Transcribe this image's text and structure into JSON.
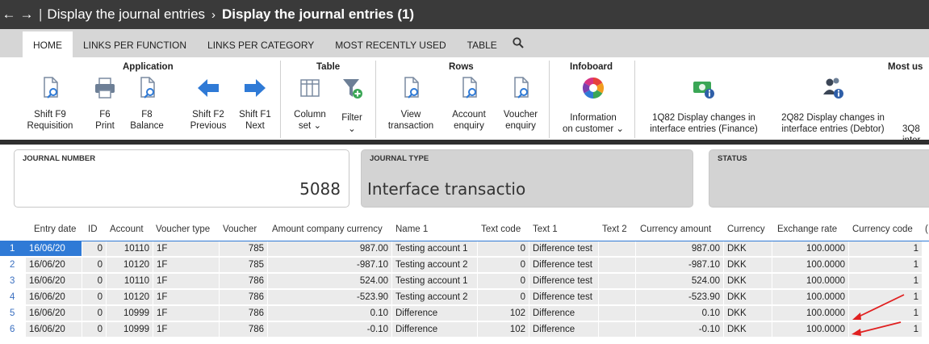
{
  "titlebar": {
    "back_glyph": "←",
    "forward_glyph": "→",
    "separator": "|",
    "breadcrumb_parent": "Display the journal entries",
    "crumb_separator": "›",
    "current": "Display the journal entries (1)"
  },
  "tabs": [
    {
      "label": "HOME",
      "active": true
    },
    {
      "label": "LINKS PER FUNCTION"
    },
    {
      "label": "LINKS PER CATEGORY"
    },
    {
      "label": "MOST RECENTLY USED"
    },
    {
      "label": "TABLE"
    }
  ],
  "ribbon": {
    "groups": {
      "application": "Application",
      "table": "Table",
      "rows": "Rows",
      "infoboard": "Infoboard",
      "most_used": "Most us"
    },
    "buttons": {
      "requisition": {
        "line1": "Shift F9",
        "line2": "Requisition",
        "icon": "document-search-icon"
      },
      "print": {
        "line1": "F6",
        "line2": "Print",
        "icon": "printer-icon"
      },
      "balance": {
        "line1": "F8",
        "line2": "Balance",
        "icon": "document-search-icon"
      },
      "previous": {
        "line1": "Shift F2",
        "line2": "Previous",
        "icon": "arrow-left-icon"
      },
      "next": {
        "line1": "Shift F1",
        "line2": "Next",
        "icon": "arrow-right-icon"
      },
      "column_set": {
        "line1": "Column",
        "line2": "set ⌄",
        "icon": "columns-icon"
      },
      "filter": {
        "line1": "Filter",
        "line2": "⌄",
        "icon": "filter-add-icon"
      },
      "view_transaction": {
        "line1": "View",
        "line2": "transaction",
        "icon": "document-search-icon"
      },
      "account_enquiry": {
        "line1": "Account",
        "line2": "enquiry",
        "icon": "document-search-icon"
      },
      "voucher_enquiry": {
        "line1": "Voucher",
        "line2": "enquiry",
        "icon": "document-search-icon"
      },
      "information_customer": {
        "line1": "Information",
        "line2": "on customer ⌄",
        "icon": "pie-chart-icon"
      },
      "display_changes_finance": {
        "line1": "1Q82 Display changes in",
        "line2": "interface entries (Finance)",
        "icon": "money-info-icon"
      },
      "display_changes_debtor": {
        "line1": "2Q82 Display changes in",
        "line2": "interface entries (Debtor)",
        "icon": "people-info-icon"
      },
      "display_changes_3": {
        "line1": "3Q8",
        "line2": "inter",
        "icon": ""
      }
    }
  },
  "fields": {
    "journal_number": {
      "label": "JOURNAL NUMBER",
      "value": "5088"
    },
    "journal_type": {
      "label": "JOURNAL TYPE",
      "value": "Interface transactio"
    },
    "status": {
      "label": "STATUS",
      "value": ""
    }
  },
  "table": {
    "columns": [
      "Entry date",
      "ID",
      "Account",
      "Voucher type",
      "Voucher",
      "Amount company currency",
      "Name 1",
      "Text code",
      "Text 1",
      "Text 2",
      "Currency amount",
      "Currency",
      "Exchange rate",
      "Currency code",
      "("
    ],
    "rows": [
      {
        "n": "1",
        "entry_date": "16/06/20",
        "id": "0",
        "account": "10110",
        "voucher_type": "1F",
        "voucher": "785",
        "amount": "987.00",
        "name1": "Testing account 1",
        "text_code": "0",
        "text1": "Difference test",
        "text2": "",
        "currency_amount": "987.00",
        "currency": "DKK",
        "exchange_rate": "100.0000",
        "currency_code": "1"
      },
      {
        "n": "2",
        "entry_date": "16/06/20",
        "id": "0",
        "account": "10120",
        "voucher_type": "1F",
        "voucher": "785",
        "amount": "-987.10",
        "name1": "Testing account 2",
        "text_code": "0",
        "text1": "Difference test",
        "text2": "",
        "currency_amount": "-987.10",
        "currency": "DKK",
        "exchange_rate": "100.0000",
        "currency_code": "1"
      },
      {
        "n": "3",
        "entry_date": "16/06/20",
        "id": "0",
        "account": "10110",
        "voucher_type": "1F",
        "voucher": "786",
        "amount": "524.00",
        "name1": "Testing account 1",
        "text_code": "0",
        "text1": "Difference test",
        "text2": "",
        "currency_amount": "524.00",
        "currency": "DKK",
        "exchange_rate": "100.0000",
        "currency_code": "1"
      },
      {
        "n": "4",
        "entry_date": "16/06/20",
        "id": "0",
        "account": "10120",
        "voucher_type": "1F",
        "voucher": "786",
        "amount": "-523.90",
        "name1": "Testing account 2",
        "text_code": "0",
        "text1": "Difference test",
        "text2": "",
        "currency_amount": "-523.90",
        "currency": "DKK",
        "exchange_rate": "100.0000",
        "currency_code": "1"
      },
      {
        "n": "5",
        "entry_date": "16/06/20",
        "id": "0",
        "account": "10999",
        "voucher_type": "1F",
        "voucher": "786",
        "amount": "0.10",
        "name1": "Difference",
        "text_code": "102",
        "text1": "Difference",
        "text2": "",
        "currency_amount": "0.10",
        "currency": "DKK",
        "exchange_rate": "100.0000",
        "currency_code": "1"
      },
      {
        "n": "6",
        "entry_date": "16/06/20",
        "id": "0",
        "account": "10999",
        "voucher_type": "1F",
        "voucher": "786",
        "amount": "-0.10",
        "name1": "Difference",
        "text_code": "102",
        "text1": "Difference",
        "text2": "",
        "currency_amount": "-0.10",
        "currency": "DKK",
        "exchange_rate": "100.0000",
        "currency_code": "1"
      }
    ]
  },
  "colors": {
    "titlebar": "#3a3a3a",
    "selection": "#2f7ad6",
    "annotation_arrow": "#e02020",
    "tool_blue": "#2f7ad6"
  }
}
